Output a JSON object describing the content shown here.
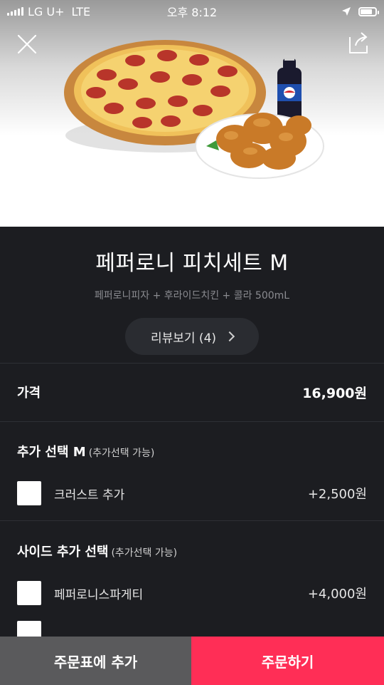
{
  "status_bar": {
    "carrier": "LG U+",
    "network": "LTE",
    "time": "오후 8:12",
    "battery_level": 0.8
  },
  "header": {
    "close_icon": "close-icon",
    "share_icon": "share-icon"
  },
  "product": {
    "title": "페퍼로니 피치세트 M",
    "subtitle": "페퍼로니피자 + 후라이드치킨 + 콜라 500mL",
    "review_label": "리뷰보기 (4)"
  },
  "price": {
    "label": "가격",
    "value": "16,900원"
  },
  "sections": [
    {
      "title": "추가 선택 M",
      "note": "(추가선택 가능)",
      "options": [
        {
          "label": "크러스트 추가",
          "price": "+2,500원"
        }
      ]
    },
    {
      "title": "사이드 추가 선택",
      "note": "(추가선택 가능)",
      "options": [
        {
          "label": "페퍼로니스파게티",
          "price": "+4,000원"
        }
      ]
    }
  ],
  "bottom": {
    "cart_label": "주문표에 추가",
    "order_label": "주문하기"
  },
  "colors": {
    "background": "#1c1d21",
    "accent": "#ff2e56",
    "cart_button": "#5a5a5c"
  }
}
